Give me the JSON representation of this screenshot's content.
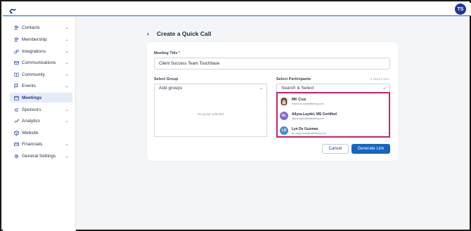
{
  "app": {
    "user_initials": "TS"
  },
  "sidebar": {
    "items": [
      {
        "label": "Contacts",
        "icon": "contacts-icon",
        "has_chevron": true,
        "active": false
      },
      {
        "label": "Membership",
        "icon": "membership-icon",
        "has_chevron": true,
        "active": false
      },
      {
        "label": "Integrations",
        "icon": "integrations-icon",
        "has_chevron": true,
        "active": false
      },
      {
        "label": "Communications",
        "icon": "communications-icon",
        "has_chevron": true,
        "active": false
      },
      {
        "label": "Community",
        "icon": "community-icon",
        "has_chevron": true,
        "active": false
      },
      {
        "label": "Events",
        "icon": "events-icon",
        "has_chevron": true,
        "active": false
      },
      {
        "label": "Meetings",
        "icon": "meetings-icon",
        "has_chevron": false,
        "active": true
      },
      {
        "label": "Sponsors",
        "icon": "sponsors-icon",
        "has_chevron": true,
        "active": false
      },
      {
        "label": "Analytics",
        "icon": "analytics-icon",
        "has_chevron": true,
        "active": false
      },
      {
        "label": "Website",
        "icon": "website-icon",
        "has_chevron": false,
        "active": false
      },
      {
        "label": "Financials",
        "icon": "financials-icon",
        "has_chevron": true,
        "active": false
      },
      {
        "label": "General Settings",
        "icon": "settings-icon",
        "has_chevron": true,
        "active": false
      }
    ]
  },
  "page": {
    "title": "Create a Quick Call"
  },
  "form": {
    "meeting_title_label": "Meeting Title",
    "required_mark": "*",
    "meeting_title_value": "Client Success Team Touchbase",
    "select_group_label": "Select Group",
    "group_placeholder": "Add groups",
    "group_empty_text": "No group selected",
    "select_participants_label": "Select Participants",
    "selected_count_text": "3 SELECTED",
    "participants_placeholder": "Search & Select",
    "participants": [
      {
        "name": "MK Cruz",
        "email": "marian.cruz@trailseeing.com",
        "initials": "",
        "avatar_color": "#5a3b2e",
        "photo": true
      },
      {
        "name": "Allysa Laydel, MS Certified",
        "email": "allysa.laydel@trailseeing.com",
        "initials": "AL",
        "avatar_color": "#7f6bd0",
        "photo": false
      },
      {
        "name": "Lyn De Guzman",
        "email": "lyn.deguzman@trailseeing.com",
        "initials": "LD",
        "avatar_color": "#3a8fd6",
        "photo": false
      }
    ]
  },
  "actions": {
    "cancel_label": "Cancel",
    "generate_label": "Generate Link"
  },
  "colors": {
    "brand": "#1d3a8f",
    "primary_button": "#1565c0",
    "highlight_border": "#c8236a",
    "active_nav_bg": "#e4ecf6"
  }
}
